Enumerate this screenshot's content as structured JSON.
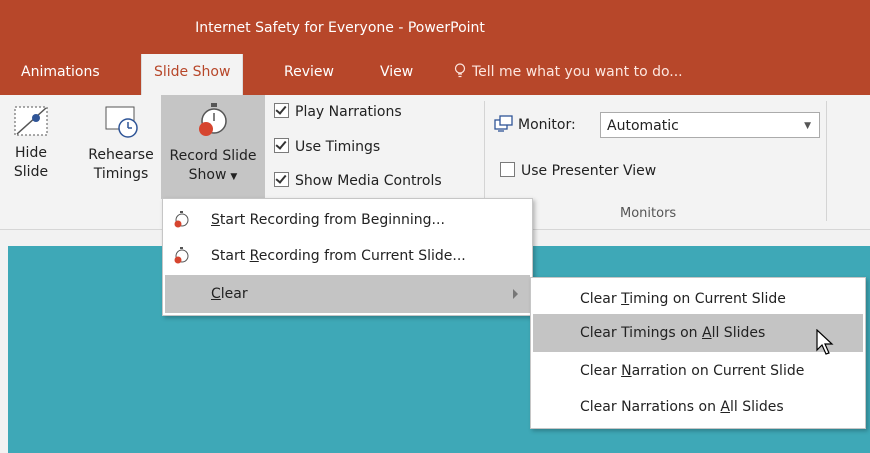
{
  "window": {
    "title": "Internet Safety for Everyone - PowerPoint"
  },
  "tabs": [
    {
      "label": "Animations",
      "active": false
    },
    {
      "label": "Slide Show",
      "active": true
    },
    {
      "label": "Review",
      "active": false
    },
    {
      "label": "View",
      "active": false
    }
  ],
  "tell_me": {
    "placeholder": "Tell me what you want to do..."
  },
  "ribbon": {
    "hide_slide": {
      "line1": "Hide",
      "line2": "Slide"
    },
    "rehearse_timings": {
      "line1": "Rehearse",
      "line2": "Timings"
    },
    "record_slide_show": {
      "line1": "Record Slide",
      "line2": "Show"
    },
    "checkboxes": [
      {
        "label": "Play Narrations",
        "checked": true
      },
      {
        "label": "Use Timings",
        "checked": true
      },
      {
        "label": "Show Media Controls",
        "checked": true
      }
    ],
    "monitor": {
      "label": "Monitor:",
      "value": "Automatic"
    },
    "presenter_view": {
      "label": "Use Presenter View",
      "checked": false
    },
    "monitors_group_label": "Monitors"
  },
  "record_menu": {
    "items": [
      {
        "pre": "",
        "ul": "S",
        "post": "tart Recording from Beginning..."
      },
      {
        "pre": "Start ",
        "ul": "R",
        "post": "ecording from Current Slide..."
      },
      {
        "pre": "",
        "ul": "C",
        "post": "lear"
      }
    ]
  },
  "clear_submenu": {
    "items": [
      {
        "pre": "Clear ",
        "ul": "T",
        "post": "iming on Current Slide"
      },
      {
        "pre": "Clear Timings on ",
        "ul": "A",
        "post": "ll Slides"
      },
      {
        "pre": "Clear ",
        "ul": "N",
        "post": "arration on Current Slide"
      },
      {
        "pre": "Clear Narrations on ",
        "ul": "A",
        "post": "ll Slides"
      }
    ]
  },
  "colors": {
    "title_bar": "#b7472a",
    "ribbon": "#f3f3f3",
    "slide": "#3ea8b7",
    "highlight": "#c4c4c4",
    "record_dot": "#d6452f"
  }
}
